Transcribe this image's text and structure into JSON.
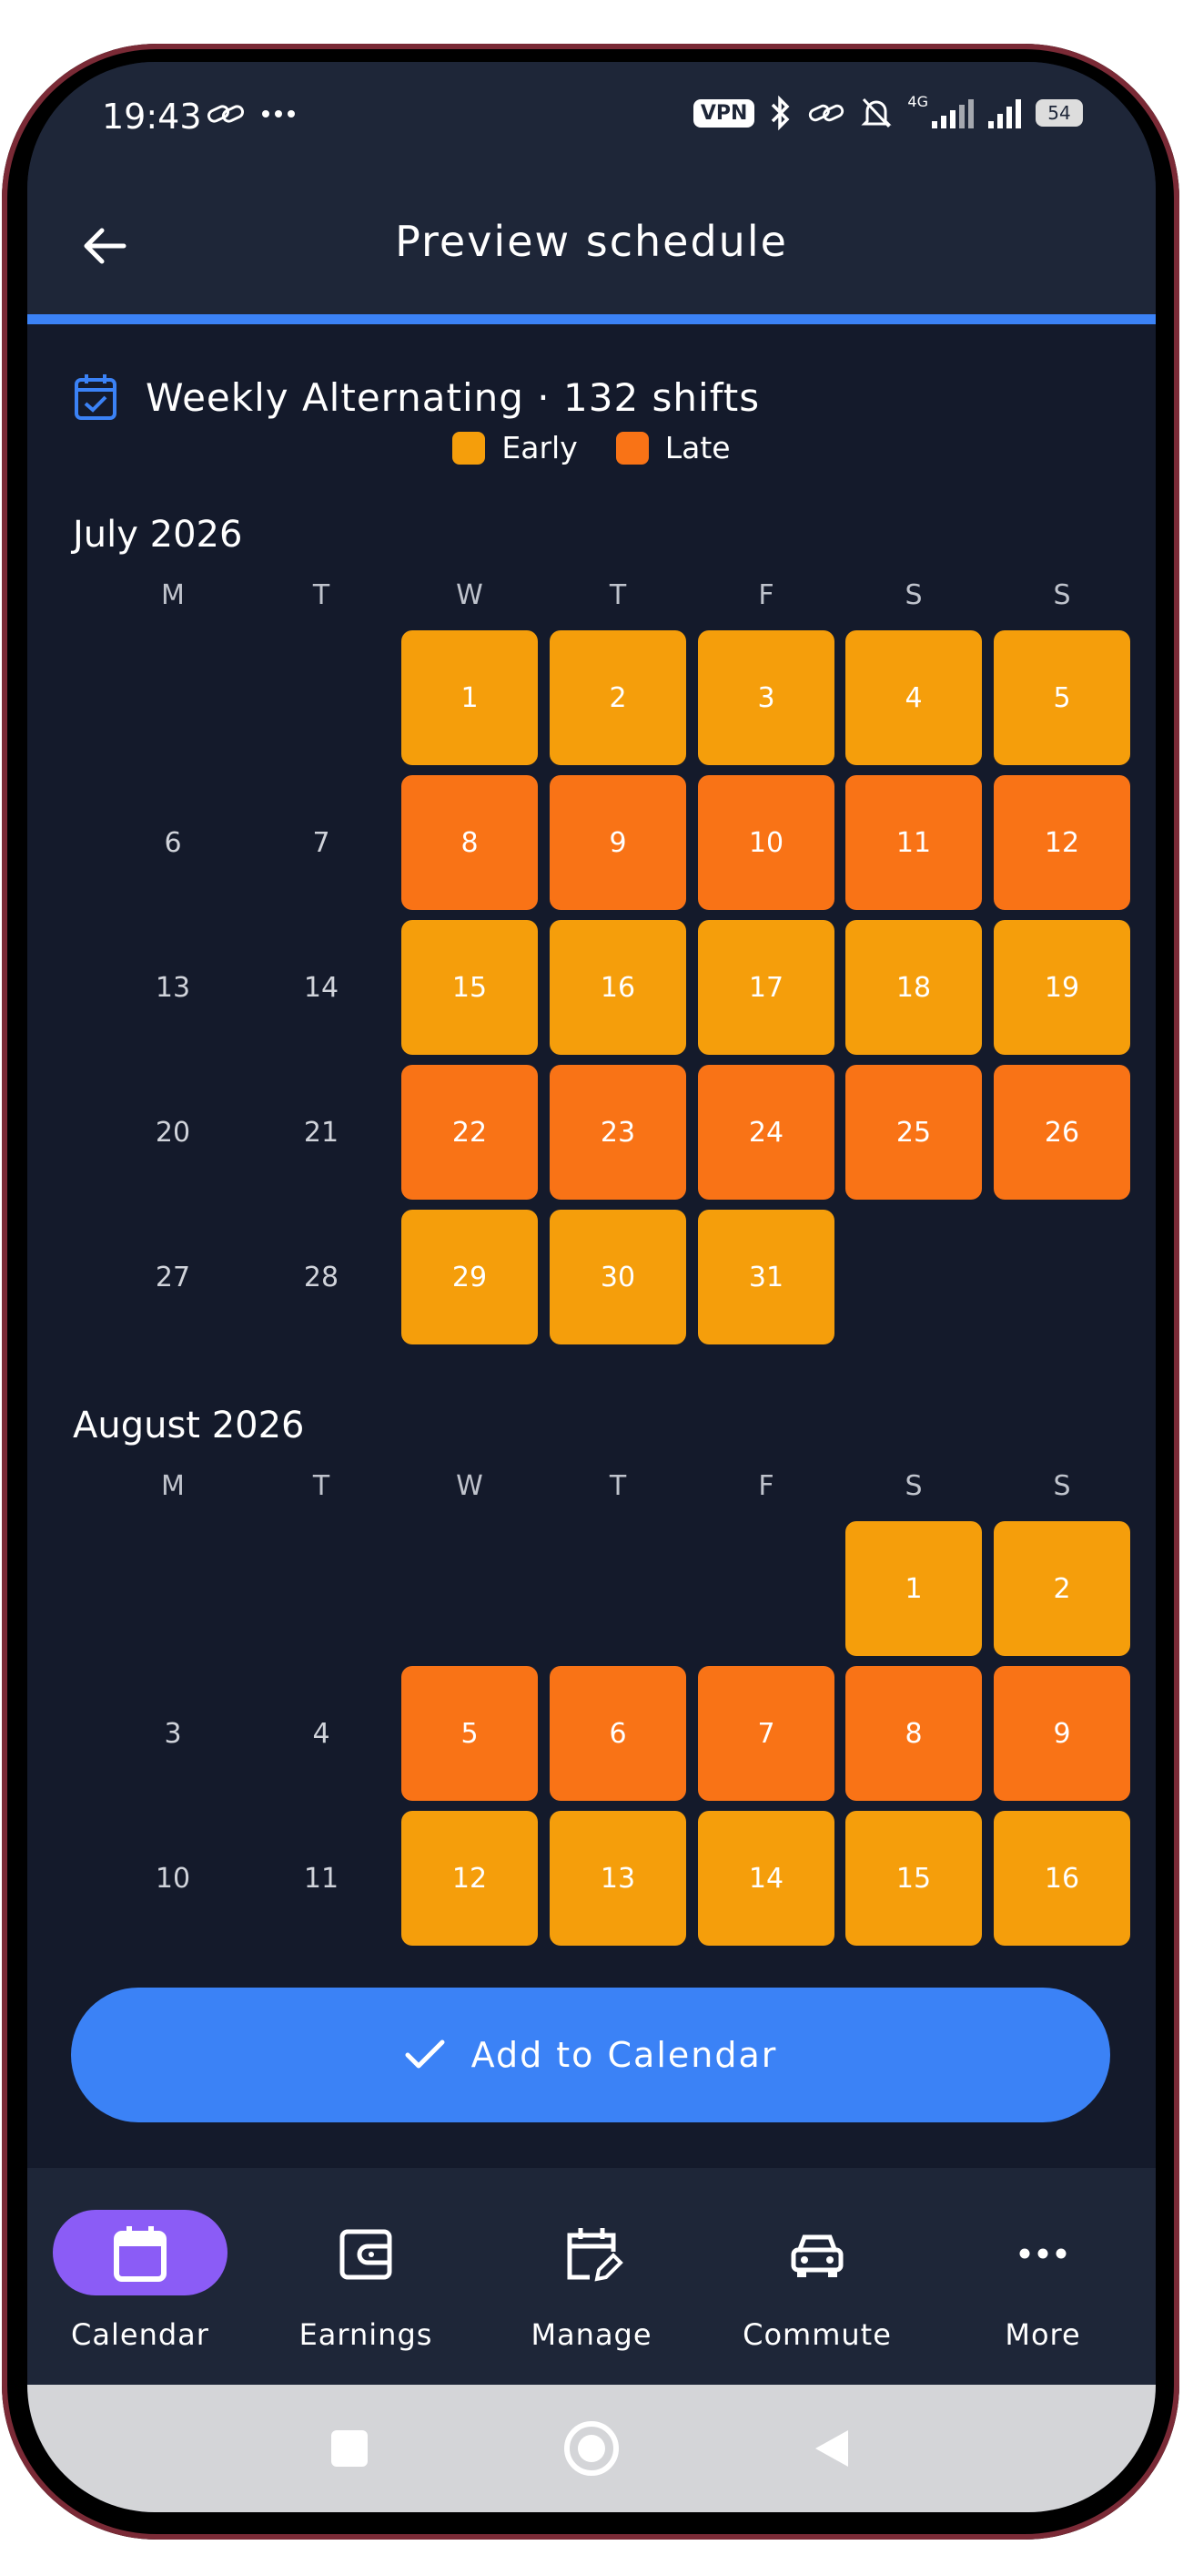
{
  "status_bar": {
    "time": "19:43",
    "vpn": "VPN",
    "network": "4G",
    "battery": "54"
  },
  "app_bar": {
    "title": "Preview schedule"
  },
  "summary": {
    "text": "Weekly Alternating · 132 shifts"
  },
  "legend": [
    {
      "label": "Early",
      "color": "#f59e0b"
    },
    {
      "label": "Late",
      "color": "#f97316"
    }
  ],
  "weekdays": [
    "M",
    "T",
    "W",
    "T",
    "F",
    "S",
    "S"
  ],
  "months": [
    {
      "title": "July 2026",
      "weeks": [
        [
          null,
          null,
          {
            "d": "1",
            "s": "early"
          },
          {
            "d": "2",
            "s": "early"
          },
          {
            "d": "3",
            "s": "early"
          },
          {
            "d": "4",
            "s": "early"
          },
          {
            "d": "5",
            "s": "early"
          }
        ],
        [
          {
            "d": "6"
          },
          {
            "d": "7"
          },
          {
            "d": "8",
            "s": "late"
          },
          {
            "d": "9",
            "s": "late"
          },
          {
            "d": "10",
            "s": "late"
          },
          {
            "d": "11",
            "s": "late"
          },
          {
            "d": "12",
            "s": "late"
          }
        ],
        [
          {
            "d": "13"
          },
          {
            "d": "14"
          },
          {
            "d": "15",
            "s": "early"
          },
          {
            "d": "16",
            "s": "early"
          },
          {
            "d": "17",
            "s": "early"
          },
          {
            "d": "18",
            "s": "early"
          },
          {
            "d": "19",
            "s": "early"
          }
        ],
        [
          {
            "d": "20"
          },
          {
            "d": "21"
          },
          {
            "d": "22",
            "s": "late"
          },
          {
            "d": "23",
            "s": "late"
          },
          {
            "d": "24",
            "s": "late"
          },
          {
            "d": "25",
            "s": "late"
          },
          {
            "d": "26",
            "s": "late"
          }
        ],
        [
          {
            "d": "27"
          },
          {
            "d": "28"
          },
          {
            "d": "29",
            "s": "early"
          },
          {
            "d": "30",
            "s": "early"
          },
          {
            "d": "31",
            "s": "early"
          },
          null,
          null
        ]
      ]
    },
    {
      "title": "August 2026",
      "weeks": [
        [
          null,
          null,
          null,
          null,
          null,
          {
            "d": "1",
            "s": "early"
          },
          {
            "d": "2",
            "s": "early"
          }
        ],
        [
          {
            "d": "3"
          },
          {
            "d": "4"
          },
          {
            "d": "5",
            "s": "late"
          },
          {
            "d": "6",
            "s": "late"
          },
          {
            "d": "7",
            "s": "late"
          },
          {
            "d": "8",
            "s": "late"
          },
          {
            "d": "9",
            "s": "late"
          }
        ],
        [
          {
            "d": "10"
          },
          {
            "d": "11"
          },
          {
            "d": "12",
            "s": "early"
          },
          {
            "d": "13",
            "s": "early"
          },
          {
            "d": "14",
            "s": "early"
          },
          {
            "d": "15",
            "s": "early"
          },
          {
            "d": "16",
            "s": "early"
          }
        ]
      ]
    }
  ],
  "shift_colors": {
    "early": "#f59e0b",
    "late": "#f97316"
  },
  "cta": {
    "label": "Add to Calendar"
  },
  "bottom_nav": [
    {
      "label": "Calendar",
      "icon": "calendar-icon",
      "active": true
    },
    {
      "label": "Earnings",
      "icon": "wallet-icon",
      "active": false
    },
    {
      "label": "Manage",
      "icon": "calendar-edit-icon",
      "active": false
    },
    {
      "label": "Commute",
      "icon": "car-icon",
      "active": false
    },
    {
      "label": "More",
      "icon": "more-icon",
      "active": false
    }
  ]
}
